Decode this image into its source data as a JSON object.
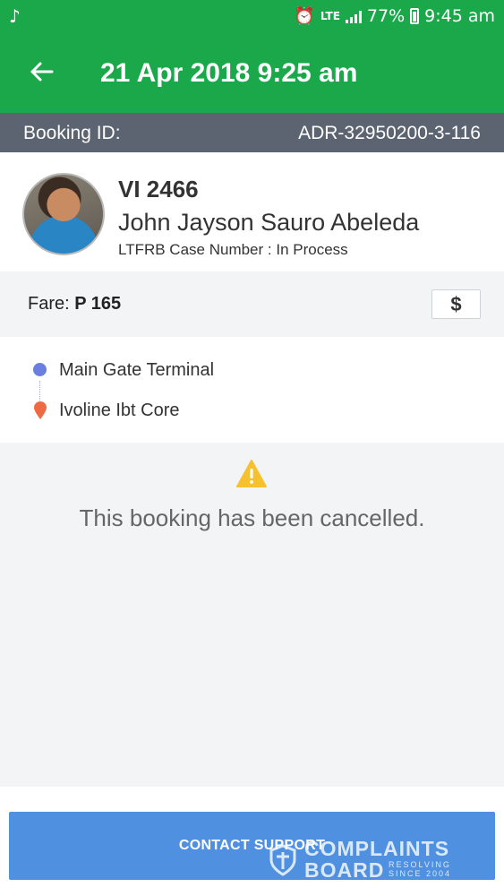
{
  "status_bar": {
    "music_icon": "music-note-icon",
    "alarm_icon": "alarm-icon",
    "network": "LTE",
    "battery_percent": "77%",
    "time": "9:45 am"
  },
  "app_bar": {
    "back_icon": "arrow-left-icon",
    "title": "21 Apr 2018 9:25 am",
    "color": "#1aa84a"
  },
  "booking": {
    "label": "Booking ID:",
    "value": "ADR-32950200-3-116"
  },
  "driver": {
    "plate": "VI 2466",
    "name": "John Jayson Sauro Abeleda",
    "case_number": "LTFRB Case Number : In Process"
  },
  "fare": {
    "label": "Fare:",
    "amount": "P 165",
    "button_icon": "dollar-icon",
    "button_symbol": "$"
  },
  "route": {
    "pickup": "Main Gate Terminal",
    "dropoff": "Ivoline Ibt Core",
    "pickup_color": "#6b7fe0",
    "dropoff_color": "#ee6a43"
  },
  "cancel": {
    "icon": "warning-icon",
    "message": "This booking has been cancelled."
  },
  "footer": {
    "contact_label": "CONTACT SUPPORT",
    "button_color": "#4f90e0"
  },
  "watermark": {
    "line1": "COMPLAINTS",
    "line2": "BOARD",
    "tag1": "RESOLVING",
    "tag2": "SINCE 2004"
  }
}
